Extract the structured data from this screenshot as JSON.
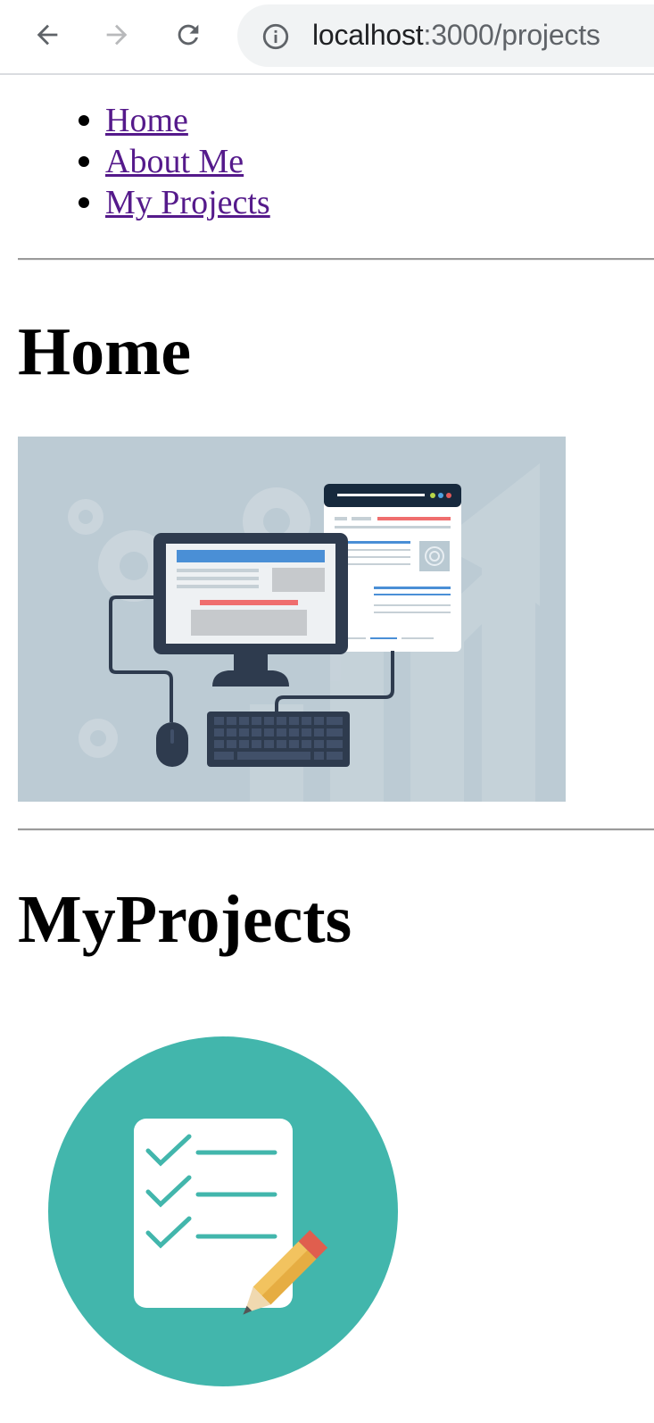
{
  "browser": {
    "url_host": "localhost",
    "url_path": ":3000/projects",
    "icons": {
      "back": "arrow-left-icon",
      "forward": "arrow-right-icon",
      "reload": "reload-icon",
      "info": "info-icon"
    }
  },
  "nav": {
    "items": [
      {
        "label": "Home"
      },
      {
        "label": "About Me"
      },
      {
        "label": "My Projects"
      }
    ]
  },
  "sections": {
    "home_title": "Home",
    "projects_title": "MyProjects"
  },
  "colors": {
    "link": "#551a8b",
    "hero_bg": "#bccbd4",
    "projects_circle": "#42b6ac"
  }
}
